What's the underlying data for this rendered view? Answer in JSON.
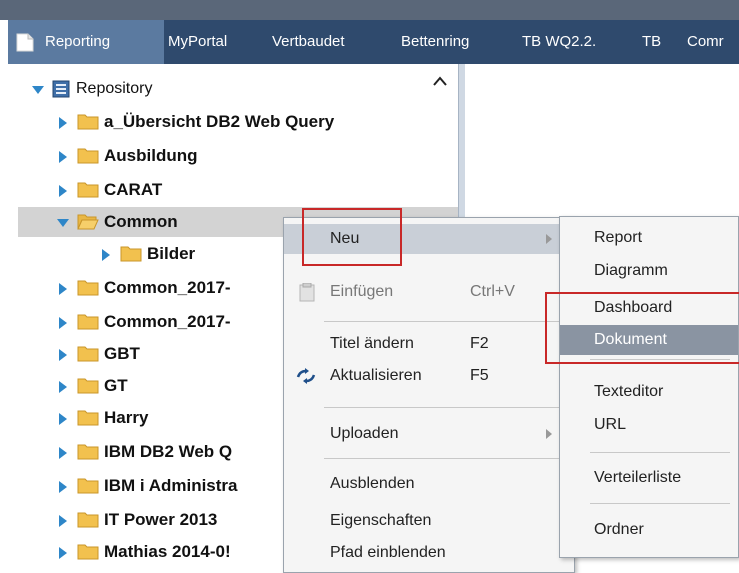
{
  "tabs": [
    "Reporting",
    "MyPortal",
    "Vertbaudet",
    "Bettenring",
    "TB WQ2.2.",
    "TB",
    "Comr"
  ],
  "tree": {
    "root_label": "Repository",
    "items": [
      "a_Übersicht DB2 Web Query",
      "Ausbildung",
      "CARAT",
      "Common",
      "Bilder",
      "Common_2017-",
      "Common_2017-",
      "GBT",
      "GT",
      "Harry",
      "IBM DB2 Web Q",
      "IBM i Administra",
      "IT Power 2013",
      "Mathias 2014-0!"
    ]
  },
  "context_menu": {
    "new": "Neu",
    "paste": "Einfügen",
    "paste_shortcut": "Ctrl+V",
    "rename": "Titel ändern",
    "rename_shortcut": "F2",
    "refresh": "Aktualisieren",
    "refresh_shortcut": "F5",
    "upload": "Uploaden",
    "hide": "Ausblenden",
    "properties": "Eigenschaften",
    "show_path": "Pfad einblenden"
  },
  "submenu": {
    "report": "Report",
    "chart": "Diagramm",
    "dashboard": "Dashboard",
    "document": "Dokument",
    "text_editor": "Texteditor",
    "url": "URL",
    "distribution_list": "Verteilerliste",
    "folder": "Ordner"
  },
  "colors": {
    "tab_bar": "#2f4a6d",
    "active_tab": "#5b7aa0",
    "tree_arrow": "#2e86c8",
    "highlight": "#8a94a2",
    "annotation_red": "#c82828"
  }
}
